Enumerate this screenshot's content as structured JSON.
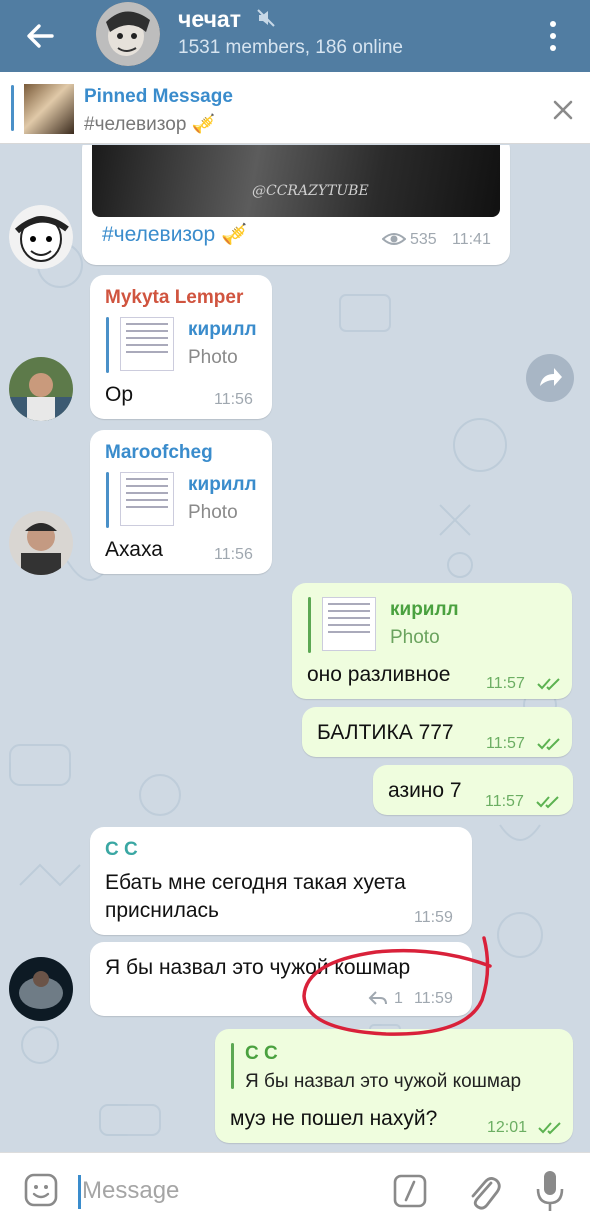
{
  "header": {
    "title": "чечат",
    "subtitle": "1531 members, 186 online"
  },
  "pinned": {
    "title": "Pinned Message",
    "text": "#челевизор 🎺"
  },
  "messages": [
    {
      "type": "in",
      "video_watermark": "@CCRAZYTUBE",
      "text": "#челевизор 🎺",
      "views": "535",
      "time": "11:41"
    },
    {
      "type": "in",
      "author": "Mykyta Lemper",
      "author_color": "#d0543f",
      "reply_name": "кирилл",
      "reply_type": "Photo",
      "text": "Ор",
      "time": "11:56"
    },
    {
      "type": "in",
      "author": "Maroofcheg",
      "author_color": "#3a8ccc",
      "reply_name": "кирилл",
      "reply_type": "Photo",
      "text": "Ахаха",
      "time": "11:56"
    },
    {
      "type": "out",
      "reply_name": "кирилл",
      "reply_type": "Photo",
      "text": "оно разливное",
      "time": "11:57"
    },
    {
      "type": "out",
      "text": "БАЛТИКА 777",
      "time": "11:57"
    },
    {
      "type": "out",
      "text": "азино 7",
      "time": "11:57"
    },
    {
      "type": "in",
      "author": "C C",
      "author_color": "#3aa7a3",
      "text": "Ебать мне сегодня такая хуета приснилась",
      "time": "11:59"
    },
    {
      "type": "in",
      "text": "Я бы назвал это чужой кошмар",
      "replies": "1",
      "time": "11:59"
    },
    {
      "type": "out",
      "reply_name": "C C",
      "reply_type": "Я бы назвал это чужой кошмар",
      "text": "муэ не пошел нахуй?",
      "time": "12:01"
    }
  ],
  "input": {
    "placeholder": "Message"
  },
  "colors": {
    "header": "#517da2",
    "accent": "#3a8ccc",
    "outgoing": "#effdde",
    "annotation": "#d9213a"
  }
}
